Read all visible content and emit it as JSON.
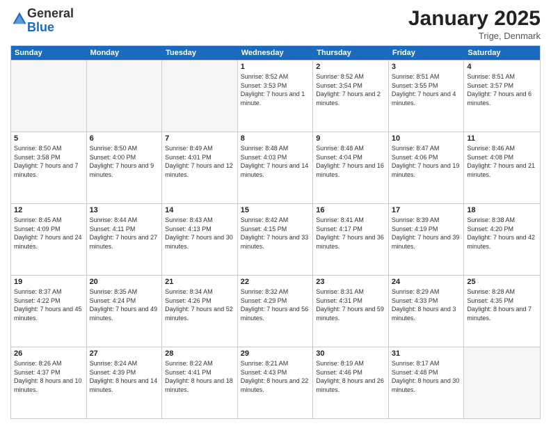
{
  "logo": {
    "general": "General",
    "blue": "Blue"
  },
  "header": {
    "month": "January 2025",
    "location": "Trige, Denmark"
  },
  "weekdays": [
    "Sunday",
    "Monday",
    "Tuesday",
    "Wednesday",
    "Thursday",
    "Friday",
    "Saturday"
  ],
  "rows": [
    [
      {
        "day": "",
        "sunrise": "",
        "sunset": "",
        "daylight": ""
      },
      {
        "day": "",
        "sunrise": "",
        "sunset": "",
        "daylight": ""
      },
      {
        "day": "",
        "sunrise": "",
        "sunset": "",
        "daylight": ""
      },
      {
        "day": "1",
        "sunrise": "Sunrise: 8:52 AM",
        "sunset": "Sunset: 3:53 PM",
        "daylight": "Daylight: 7 hours and 1 minute."
      },
      {
        "day": "2",
        "sunrise": "Sunrise: 8:52 AM",
        "sunset": "Sunset: 3:54 PM",
        "daylight": "Daylight: 7 hours and 2 minutes."
      },
      {
        "day": "3",
        "sunrise": "Sunrise: 8:51 AM",
        "sunset": "Sunset: 3:55 PM",
        "daylight": "Daylight: 7 hours and 4 minutes."
      },
      {
        "day": "4",
        "sunrise": "Sunrise: 8:51 AM",
        "sunset": "Sunset: 3:57 PM",
        "daylight": "Daylight: 7 hours and 6 minutes."
      }
    ],
    [
      {
        "day": "5",
        "sunrise": "Sunrise: 8:50 AM",
        "sunset": "Sunset: 3:58 PM",
        "daylight": "Daylight: 7 hours and 7 minutes."
      },
      {
        "day": "6",
        "sunrise": "Sunrise: 8:50 AM",
        "sunset": "Sunset: 4:00 PM",
        "daylight": "Daylight: 7 hours and 9 minutes."
      },
      {
        "day": "7",
        "sunrise": "Sunrise: 8:49 AM",
        "sunset": "Sunset: 4:01 PM",
        "daylight": "Daylight: 7 hours and 12 minutes."
      },
      {
        "day": "8",
        "sunrise": "Sunrise: 8:48 AM",
        "sunset": "Sunset: 4:03 PM",
        "daylight": "Daylight: 7 hours and 14 minutes."
      },
      {
        "day": "9",
        "sunrise": "Sunrise: 8:48 AM",
        "sunset": "Sunset: 4:04 PM",
        "daylight": "Daylight: 7 hours and 16 minutes."
      },
      {
        "day": "10",
        "sunrise": "Sunrise: 8:47 AM",
        "sunset": "Sunset: 4:06 PM",
        "daylight": "Daylight: 7 hours and 19 minutes."
      },
      {
        "day": "11",
        "sunrise": "Sunrise: 8:46 AM",
        "sunset": "Sunset: 4:08 PM",
        "daylight": "Daylight: 7 hours and 21 minutes."
      }
    ],
    [
      {
        "day": "12",
        "sunrise": "Sunrise: 8:45 AM",
        "sunset": "Sunset: 4:09 PM",
        "daylight": "Daylight: 7 hours and 24 minutes."
      },
      {
        "day": "13",
        "sunrise": "Sunrise: 8:44 AM",
        "sunset": "Sunset: 4:11 PM",
        "daylight": "Daylight: 7 hours and 27 minutes."
      },
      {
        "day": "14",
        "sunrise": "Sunrise: 8:43 AM",
        "sunset": "Sunset: 4:13 PM",
        "daylight": "Daylight: 7 hours and 30 minutes."
      },
      {
        "day": "15",
        "sunrise": "Sunrise: 8:42 AM",
        "sunset": "Sunset: 4:15 PM",
        "daylight": "Daylight: 7 hours and 33 minutes."
      },
      {
        "day": "16",
        "sunrise": "Sunrise: 8:41 AM",
        "sunset": "Sunset: 4:17 PM",
        "daylight": "Daylight: 7 hours and 36 minutes."
      },
      {
        "day": "17",
        "sunrise": "Sunrise: 8:39 AM",
        "sunset": "Sunset: 4:19 PM",
        "daylight": "Daylight: 7 hours and 39 minutes."
      },
      {
        "day": "18",
        "sunrise": "Sunrise: 8:38 AM",
        "sunset": "Sunset: 4:20 PM",
        "daylight": "Daylight: 7 hours and 42 minutes."
      }
    ],
    [
      {
        "day": "19",
        "sunrise": "Sunrise: 8:37 AM",
        "sunset": "Sunset: 4:22 PM",
        "daylight": "Daylight: 7 hours and 45 minutes."
      },
      {
        "day": "20",
        "sunrise": "Sunrise: 8:35 AM",
        "sunset": "Sunset: 4:24 PM",
        "daylight": "Daylight: 7 hours and 49 minutes."
      },
      {
        "day": "21",
        "sunrise": "Sunrise: 8:34 AM",
        "sunset": "Sunset: 4:26 PM",
        "daylight": "Daylight: 7 hours and 52 minutes."
      },
      {
        "day": "22",
        "sunrise": "Sunrise: 8:32 AM",
        "sunset": "Sunset: 4:29 PM",
        "daylight": "Daylight: 7 hours and 56 minutes."
      },
      {
        "day": "23",
        "sunrise": "Sunrise: 8:31 AM",
        "sunset": "Sunset: 4:31 PM",
        "daylight": "Daylight: 7 hours and 59 minutes."
      },
      {
        "day": "24",
        "sunrise": "Sunrise: 8:29 AM",
        "sunset": "Sunset: 4:33 PM",
        "daylight": "Daylight: 8 hours and 3 minutes."
      },
      {
        "day": "25",
        "sunrise": "Sunrise: 8:28 AM",
        "sunset": "Sunset: 4:35 PM",
        "daylight": "Daylight: 8 hours and 7 minutes."
      }
    ],
    [
      {
        "day": "26",
        "sunrise": "Sunrise: 8:26 AM",
        "sunset": "Sunset: 4:37 PM",
        "daylight": "Daylight: 8 hours and 10 minutes."
      },
      {
        "day": "27",
        "sunrise": "Sunrise: 8:24 AM",
        "sunset": "Sunset: 4:39 PM",
        "daylight": "Daylight: 8 hours and 14 minutes."
      },
      {
        "day": "28",
        "sunrise": "Sunrise: 8:22 AM",
        "sunset": "Sunset: 4:41 PM",
        "daylight": "Daylight: 8 hours and 18 minutes."
      },
      {
        "day": "29",
        "sunrise": "Sunrise: 8:21 AM",
        "sunset": "Sunset: 4:43 PM",
        "daylight": "Daylight: 8 hours and 22 minutes."
      },
      {
        "day": "30",
        "sunrise": "Sunrise: 8:19 AM",
        "sunset": "Sunset: 4:46 PM",
        "daylight": "Daylight: 8 hours and 26 minutes."
      },
      {
        "day": "31",
        "sunrise": "Sunrise: 8:17 AM",
        "sunset": "Sunset: 4:48 PM",
        "daylight": "Daylight: 8 hours and 30 minutes."
      },
      {
        "day": "",
        "sunrise": "",
        "sunset": "",
        "daylight": ""
      }
    ]
  ]
}
